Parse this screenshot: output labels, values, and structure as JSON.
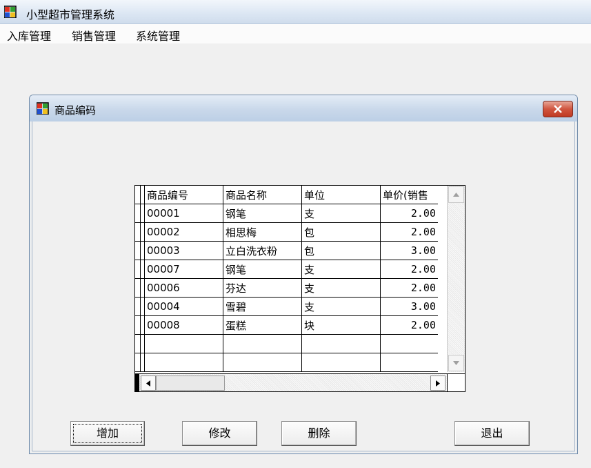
{
  "app": {
    "title": "小型超市管理系统",
    "icon": "app-windows-icon"
  },
  "menu": {
    "items": [
      "入库管理",
      "销售管理",
      "系统管理"
    ]
  },
  "dialog": {
    "title": "商品编码",
    "icon": "dialog-windows-icon",
    "close_icon": "close-x-icon"
  },
  "grid": {
    "columns": [
      "商品编号",
      "商品名称",
      "单位",
      "单价(销售"
    ],
    "rows": [
      [
        "00001",
        "钢笔",
        "支",
        "2.00"
      ],
      [
        "00002",
        "相思梅",
        "包",
        "2.00"
      ],
      [
        "00003",
        "立白洗衣粉",
        "包",
        "3.00"
      ],
      [
        "00007",
        "钢笔",
        "支",
        "2.00"
      ],
      [
        "00006",
        "芬达",
        "支",
        "2.00"
      ],
      [
        "00004",
        "雪碧",
        "支",
        "3.00"
      ],
      [
        "00008",
        "蛋糕",
        "块",
        "2.00"
      ]
    ],
    "empty_rows": 2
  },
  "buttons": {
    "add": "增加",
    "edit": "修改",
    "delete": "删除",
    "exit": "退出"
  }
}
